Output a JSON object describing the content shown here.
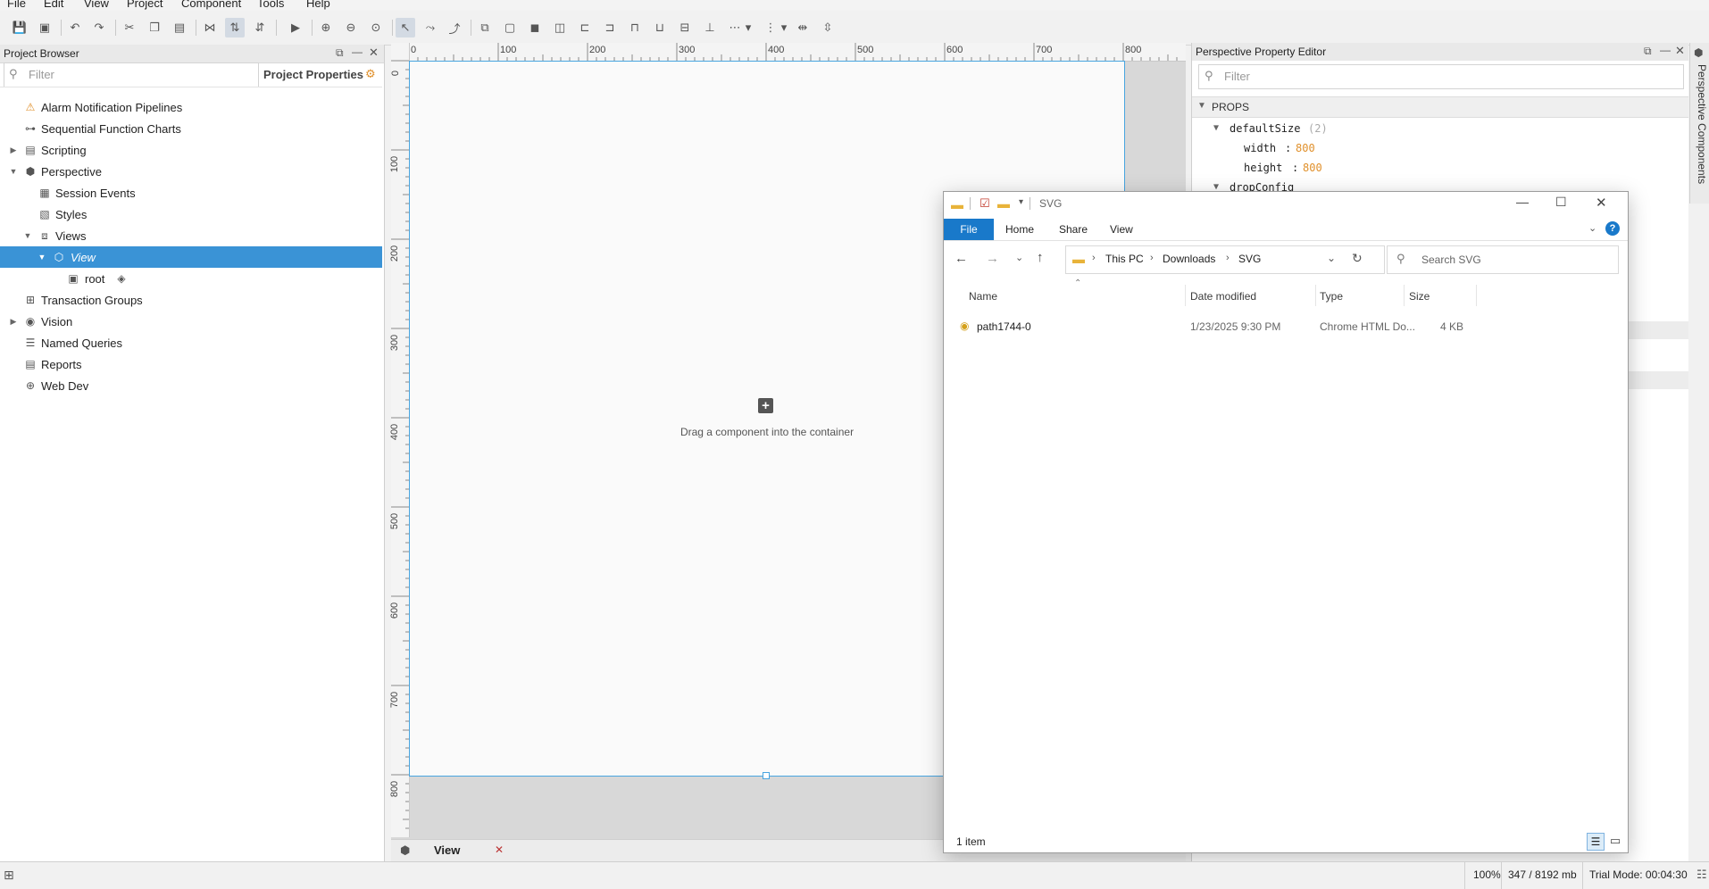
{
  "menu": {
    "items": [
      "File",
      "Edit",
      "View",
      "Project",
      "Component",
      "Tools",
      "Help"
    ]
  },
  "project_browser": {
    "title": "Project Browser",
    "filter_placeholder": "Filter",
    "properties_label": "Project Properties",
    "tree": [
      {
        "label": "Alarm Notification Pipelines",
        "icon": "alarm-pipeline-icon"
      },
      {
        "label": "Sequential Function Charts",
        "icon": "sfc-icon"
      },
      {
        "label": "Scripting",
        "icon": "script-icon"
      },
      {
        "label": "Perspective",
        "icon": "perspective-icon"
      },
      {
        "label": "Session Events",
        "icon": "session-events-icon"
      },
      {
        "label": "Styles",
        "icon": "styles-icon"
      },
      {
        "label": "Views",
        "icon": "views-icon"
      },
      {
        "label": "View",
        "icon": "view-icon"
      },
      {
        "label": "root",
        "icon": "container-icon"
      },
      {
        "label": "Transaction Groups",
        "icon": "transaction-groups-icon"
      },
      {
        "label": "Vision",
        "icon": "vision-icon"
      },
      {
        "label": "Named Queries",
        "icon": "named-queries-icon"
      },
      {
        "label": "Reports",
        "icon": "reports-icon"
      },
      {
        "label": "Web Dev",
        "icon": "web-dev-icon"
      }
    ]
  },
  "designer": {
    "ruler_top_labels": [
      "0",
      "100",
      "200",
      "300",
      "400",
      "500",
      "600",
      "700",
      "800"
    ],
    "ruler_left_labels": [
      "0",
      "100",
      "200",
      "300",
      "400",
      "500",
      "600",
      "700",
      "800"
    ],
    "drop_hint": "Drag a component into the container",
    "tab_label": "View"
  },
  "property_editor": {
    "title": "Perspective Property Editor",
    "filter_placeholder": "Filter",
    "section": "PROPS",
    "default_size": {
      "key": "defaultSize",
      "count": "(2)"
    },
    "width": {
      "key": "width",
      "value": "800"
    },
    "height": {
      "key": "height",
      "value": "800"
    },
    "next_key": "dropConfig"
  },
  "side_tab": {
    "label": "Perspective Components"
  },
  "explorer": {
    "window_title": "SVG",
    "ribbon_tabs": [
      "File",
      "Home",
      "Share",
      "View"
    ],
    "breadcrumb": [
      "This PC",
      "Downloads",
      "SVG"
    ],
    "search_placeholder": "Search SVG",
    "columns": [
      "Name",
      "Date modified",
      "Type",
      "Size"
    ],
    "rows": [
      {
        "name": "path1744-0",
        "date": "1/23/2025 9:30 PM",
        "type": "Chrome HTML Do...",
        "size": "4 KB"
      }
    ],
    "status": "1 item"
  },
  "statusbar": {
    "zoom": "100%",
    "memory": "347 / 8192 mb",
    "trial": "Trial Mode: 00:04:30"
  },
  "colors": {
    "selection": "#3a93d6",
    "accent": "#48a5e0",
    "orange": "#e0902b",
    "file_blue": "#1979ca"
  }
}
